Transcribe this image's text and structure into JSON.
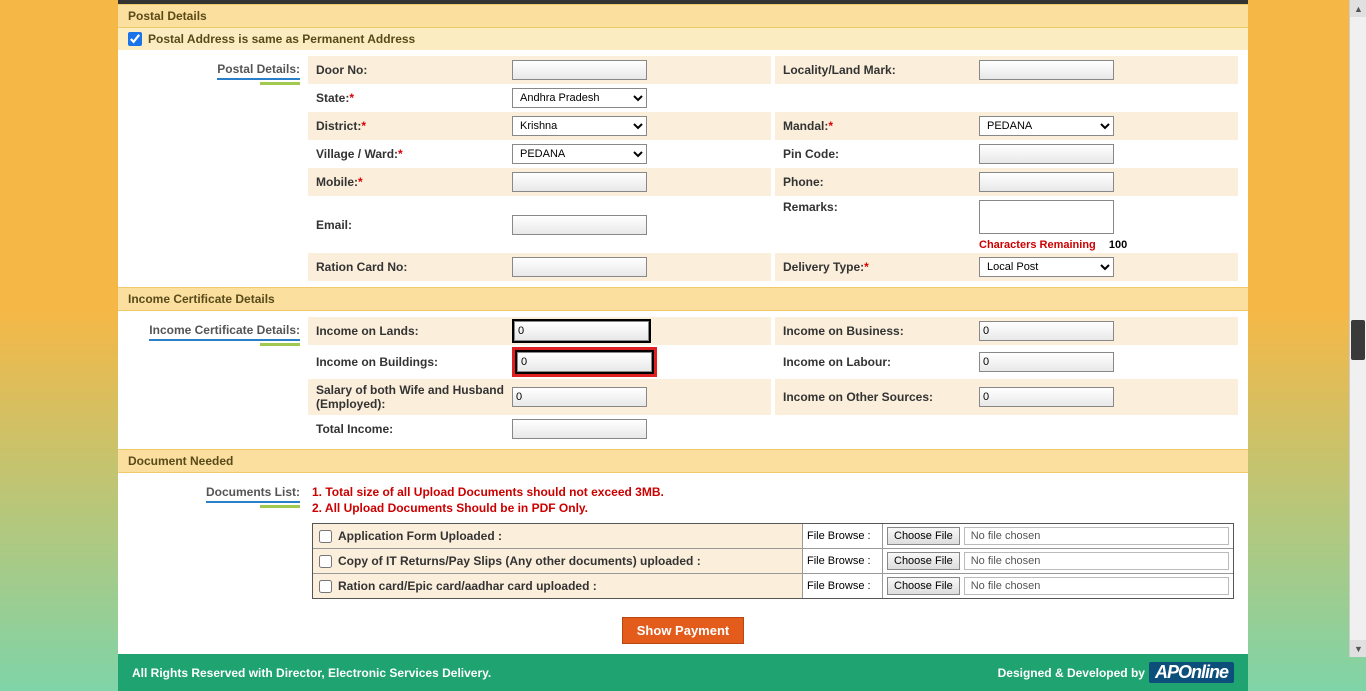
{
  "sections": {
    "postal": {
      "title": "Postal Details",
      "same_as_label": "Postal Address is same as Permanent Address",
      "side_label": "Postal Details:",
      "fields": {
        "door_no": "Door No:",
        "locality": "Locality/Land Mark:",
        "state": "State:",
        "district": "District:",
        "mandal": "Mandal:",
        "village": "Village / Ward:",
        "pincode": "Pin Code:",
        "mobile": "Mobile:",
        "phone": "Phone:",
        "email": "Email:",
        "remarks": "Remarks:",
        "ration": "Ration Card No:",
        "delivery": "Delivery Type:"
      },
      "values": {
        "state": "Andhra Pradesh",
        "district": "Krishna",
        "mandal": "PEDANA",
        "village": "PEDANA",
        "delivery": "Local Post"
      },
      "remarks_remaining_label": "Characters Remaining",
      "remarks_remaining_count": "100"
    },
    "income": {
      "title": "Income Certificate Details",
      "side_label": "Income Certificate Details:",
      "fields": {
        "lands": "Income on Lands:",
        "business": "Income on Business:",
        "buildings": "Income on Buildings:",
        "labour": "Income on Labour:",
        "salary": "Salary of both Wife and Husband (Employed):",
        "other": "Income on Other Sources:",
        "total": "Total Income:"
      },
      "values": {
        "lands": "0",
        "business": "0",
        "buildings": "0",
        "labour": "0",
        "salary": "0",
        "other": "0",
        "total": ""
      }
    },
    "documents": {
      "title": "Document Needed",
      "side_label": "Documents List:",
      "notes": [
        "1. Total size of all Upload Documents should not exceed 3MB.",
        "2. All Upload Documents Should be in PDF Only."
      ],
      "rows": [
        "Application Form Uploaded :",
        "Copy of IT Returns/Pay Slips (Any other documents) uploaded :",
        "Ration card/Epic card/aadhar card uploaded :"
      ],
      "file_browse_label": "File Browse :",
      "choose_file_label": "Choose File",
      "no_file_label": "No file chosen"
    }
  },
  "buttons": {
    "show_payment": "Show Payment"
  },
  "footer": {
    "left": "All Rights Reserved with Director, Electronic Services Delivery.",
    "right_prefix": "Designed & Developed by",
    "logo_text": "APOnline"
  }
}
